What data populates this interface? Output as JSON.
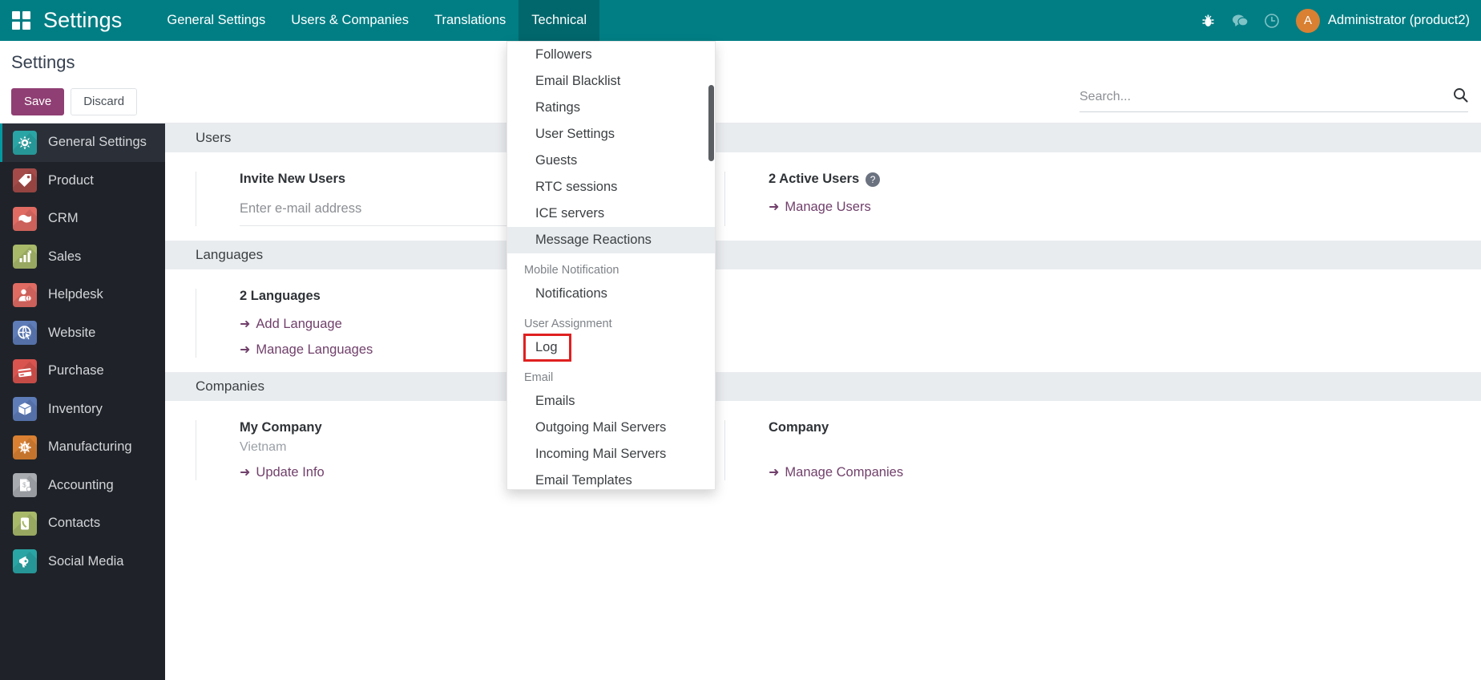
{
  "navbar": {
    "brand": "Settings",
    "apps_icon": "apps-grid-icon",
    "menu_items": [
      {
        "label": "General Settings",
        "active": false
      },
      {
        "label": "Users & Companies",
        "active": false
      },
      {
        "label": "Translations",
        "active": false
      },
      {
        "label": "Technical",
        "active": true
      }
    ],
    "icons": [
      {
        "name": "bug-icon"
      },
      {
        "name": "chat-bubble-icon"
      },
      {
        "name": "clock-icon"
      }
    ],
    "user": {
      "initial": "A",
      "name": "Administrator (product2)"
    },
    "accent_color": "#017e84"
  },
  "control_panel": {
    "breadcrumb": "Settings",
    "save_label": "Save",
    "discard_label": "Discard",
    "save_color": "#8f3f73",
    "search_placeholder": "Search...",
    "search_value": "",
    "search_icon": "search-icon"
  },
  "sidebar": {
    "items": [
      {
        "label": "General Settings",
        "icon": "gear-icon",
        "color": "#2aa5a5",
        "active": true
      },
      {
        "label": "Product",
        "icon": "tag-icon",
        "color": "#a44b49",
        "active": false
      },
      {
        "label": "CRM",
        "icon": "handshake-icon",
        "color": "#e06b63",
        "active": false
      },
      {
        "label": "Sales",
        "icon": "bar-chart-icon",
        "color": "#a8b96a",
        "active": false
      },
      {
        "label": "Helpdesk",
        "icon": "support-person-icon",
        "color": "#e06b63",
        "active": false
      },
      {
        "label": "Website",
        "icon": "globe-cursor-icon",
        "color": "#5d7cb8",
        "active": false
      },
      {
        "label": "Purchase",
        "icon": "credit-card-icon",
        "color": "#d9534f",
        "active": false
      },
      {
        "label": "Inventory",
        "icon": "box-icon",
        "color": "#5d7cb8",
        "active": false
      },
      {
        "label": "Manufacturing",
        "icon": "gear-cog-icon",
        "color": "#d98032",
        "active": false
      },
      {
        "label": "Accounting",
        "icon": "invoice-icon",
        "color": "#a8acb1",
        "active": false
      },
      {
        "label": "Contacts",
        "icon": "phone-icon",
        "color": "#a8b96a",
        "active": false
      },
      {
        "label": "Social Media",
        "icon": "megaphone-icon",
        "color": "#2aa5a5",
        "active": false
      }
    ]
  },
  "main": {
    "sections": [
      {
        "title": "Users",
        "left": {
          "setting_title": "Invite New Users",
          "input_placeholder": "Enter e-mail address",
          "input_value": ""
        },
        "right": {
          "setting_title": "2 Active Users",
          "help_icon": "question-mark-icon",
          "link": "Manage Users"
        }
      },
      {
        "title": "Languages",
        "left": {
          "setting_title": "2 Languages",
          "links": [
            "Add Language",
            "Manage Languages"
          ]
        }
      },
      {
        "title": "Companies",
        "left": {
          "setting_title": "My Company",
          "subtitle": "Vietnam",
          "link": "Update Info"
        },
        "right": {
          "setting_title": "Company",
          "link": "Manage Companies"
        }
      }
    ]
  },
  "dropdown": {
    "open": true,
    "highlight_color": "#e02020",
    "entries": [
      {
        "type": "item",
        "label": "Followers",
        "state": "normal"
      },
      {
        "type": "item",
        "label": "Email Blacklist",
        "state": "normal"
      },
      {
        "type": "item",
        "label": "Ratings",
        "state": "normal"
      },
      {
        "type": "item",
        "label": "User Settings",
        "state": "normal"
      },
      {
        "type": "item",
        "label": "Guests",
        "state": "normal"
      },
      {
        "type": "item",
        "label": "RTC sessions",
        "state": "normal"
      },
      {
        "type": "item",
        "label": "ICE servers",
        "state": "normal"
      },
      {
        "type": "item",
        "label": "Message Reactions",
        "state": "hovered"
      },
      {
        "type": "header",
        "label": "Mobile Notification"
      },
      {
        "type": "item",
        "label": "Notifications",
        "state": "normal"
      },
      {
        "type": "header",
        "label": "User Assignment"
      },
      {
        "type": "item",
        "label": "Log",
        "state": "boxed"
      },
      {
        "type": "header",
        "label": "Email"
      },
      {
        "type": "item",
        "label": "Emails",
        "state": "normal"
      },
      {
        "type": "item",
        "label": "Outgoing Mail Servers",
        "state": "normal"
      },
      {
        "type": "item",
        "label": "Incoming Mail Servers",
        "state": "normal"
      },
      {
        "type": "item",
        "label": "Email Templates",
        "state": "normal"
      }
    ]
  }
}
